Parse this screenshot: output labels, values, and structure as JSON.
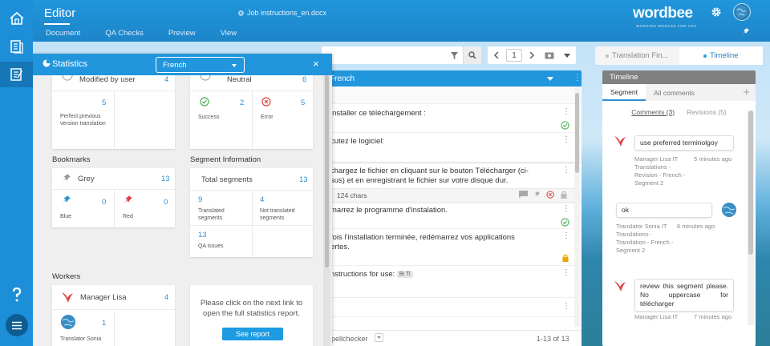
{
  "app": {
    "title": "Editor",
    "document": "Job instructions_en.docx"
  },
  "menu": [
    "Document",
    "QA Checks",
    "Preview",
    "View"
  ],
  "brand": {
    "logo_a": "wordbee",
    "tagline": "WORKING WORLDS FOR YOU"
  },
  "pager": {
    "page": "1"
  },
  "right_tabs": {
    "translation": "Translation Fin...",
    "timeline": "Timeline"
  },
  "segments": {
    "header": "French",
    "rows": [
      {
        "text": "installer ce téléchargement :"
      },
      {
        "text": "cutez le logiciel:"
      },
      {
        "text1": "chargez le fichier en cliquant sur le bouton Télécharger (ci-",
        "text2": "sus) et en enregistrant le fichier sur votre disque dur.",
        "chars": "124 chars"
      },
      {
        "text": "marrez le programme d'instalation."
      },
      {
        "text1": "fois l'installation terminée, redémarrez vos applications",
        "text2": "ertes."
      },
      {
        "text": "nstructions for use:",
        "tag": "Bi Ti"
      }
    ],
    "footer_left": "pellchecker",
    "footer_right": "1-13 of 13"
  },
  "stats": {
    "title": "Statistics",
    "language": "French",
    "top_left": {
      "label": "Modified by user",
      "value": "4",
      "sub_value": "5",
      "sub_label": "Perfect previous version translation"
    },
    "top_right": {
      "label": "Neutral",
      "value": "6",
      "success_value": "2",
      "success_label": "Success",
      "error_value": "5",
      "error_label": "Error"
    },
    "bookmarks": {
      "title": "Bookmarks",
      "grey_label": "Grey",
      "grey_value": "13",
      "blue_value": "0",
      "blue_label": "Blue",
      "red_value": "0",
      "red_label": "Red"
    },
    "segment_info": {
      "title": "Segment Information",
      "total_label": "Total segments",
      "total_value": "13",
      "translated_value": "9",
      "translated_label": "Translated segments",
      "not_translated_value": "4",
      "not_translated_label": "Not translated segments",
      "qa_value": "13",
      "qa_label": "QA issues"
    },
    "workers": {
      "title": "Workers",
      "manager_label": "Manager Lisa",
      "manager_value": "4",
      "translator_value": "1",
      "translator_label": "Translator Sonia"
    },
    "report": {
      "text": "Please click on the next link to open the full statistics report.",
      "button": "See report"
    }
  },
  "timeline": {
    "header": "Timeline",
    "tabs": [
      "Segment",
      "All comments"
    ],
    "sub": {
      "comments": "Comments (3)",
      "revisions": "Revisions (5)"
    },
    "items": [
      {
        "text": "use preferred terminolgoy",
        "meta": "Manager Lisa IT Translations - Revision - French - Segment 2",
        "time": "5 minutes ago"
      },
      {
        "text": "ok",
        "meta": "Translator Sonia IT Translations - Translation - French - Segment 2",
        "time": "6 minutes ago"
      },
      {
        "text": "review this segment please. No uppercase for télécharger",
        "meta": "Manager Lisa IT",
        "time": "7 minutes ago"
      }
    ]
  },
  "colors": {
    "primary": "#2196dc",
    "success": "#4caf50",
    "error": "#e04040",
    "lock": "#f0a500"
  }
}
